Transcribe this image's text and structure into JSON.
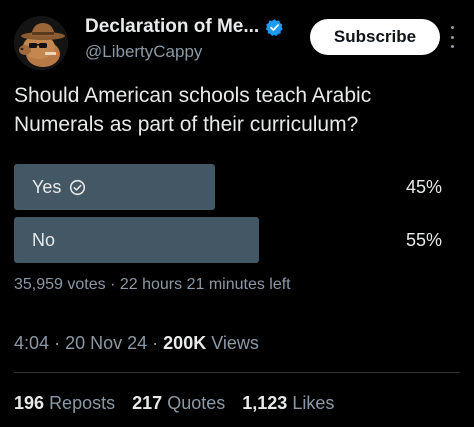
{
  "header": {
    "display_name": "Declaration of Me...",
    "handle": "@LibertyCappy",
    "subscribe_label": "Subscribe",
    "avatar_icon": "capybara-cowboy-avatar-icon",
    "verified_icon": "verified-badge-icon",
    "more_icon": "more-vertical-icon"
  },
  "post": {
    "question": "Should American schools teach Arabic Numerals as part of their curriculum?"
  },
  "poll": {
    "options": [
      {
        "label": "Yes",
        "percent_text": "45%",
        "percent": 45,
        "selected": true
      },
      {
        "label": "No",
        "percent_text": "55%",
        "percent": 55,
        "selected": false
      }
    ],
    "votes": "35,959 votes",
    "separator": "·",
    "time_left": "22 hours 21 minutes left"
  },
  "timestamp": {
    "time": "4:04",
    "sep1": "·",
    "date": "20 Nov 24",
    "sep2": "·",
    "views_count": "200K",
    "views_label": "Views"
  },
  "stats": {
    "reposts_count": "196",
    "reposts_label": "Reposts",
    "quotes_count": "217",
    "quotes_label": "Quotes",
    "likes_count": "1,123",
    "likes_label": "Likes"
  },
  "colors": {
    "background": "#000000",
    "text_primary": "#e7e9ea",
    "text_secondary": "#8b98a5",
    "poll_bar": "#435764",
    "verified": "#1d9bf0"
  }
}
